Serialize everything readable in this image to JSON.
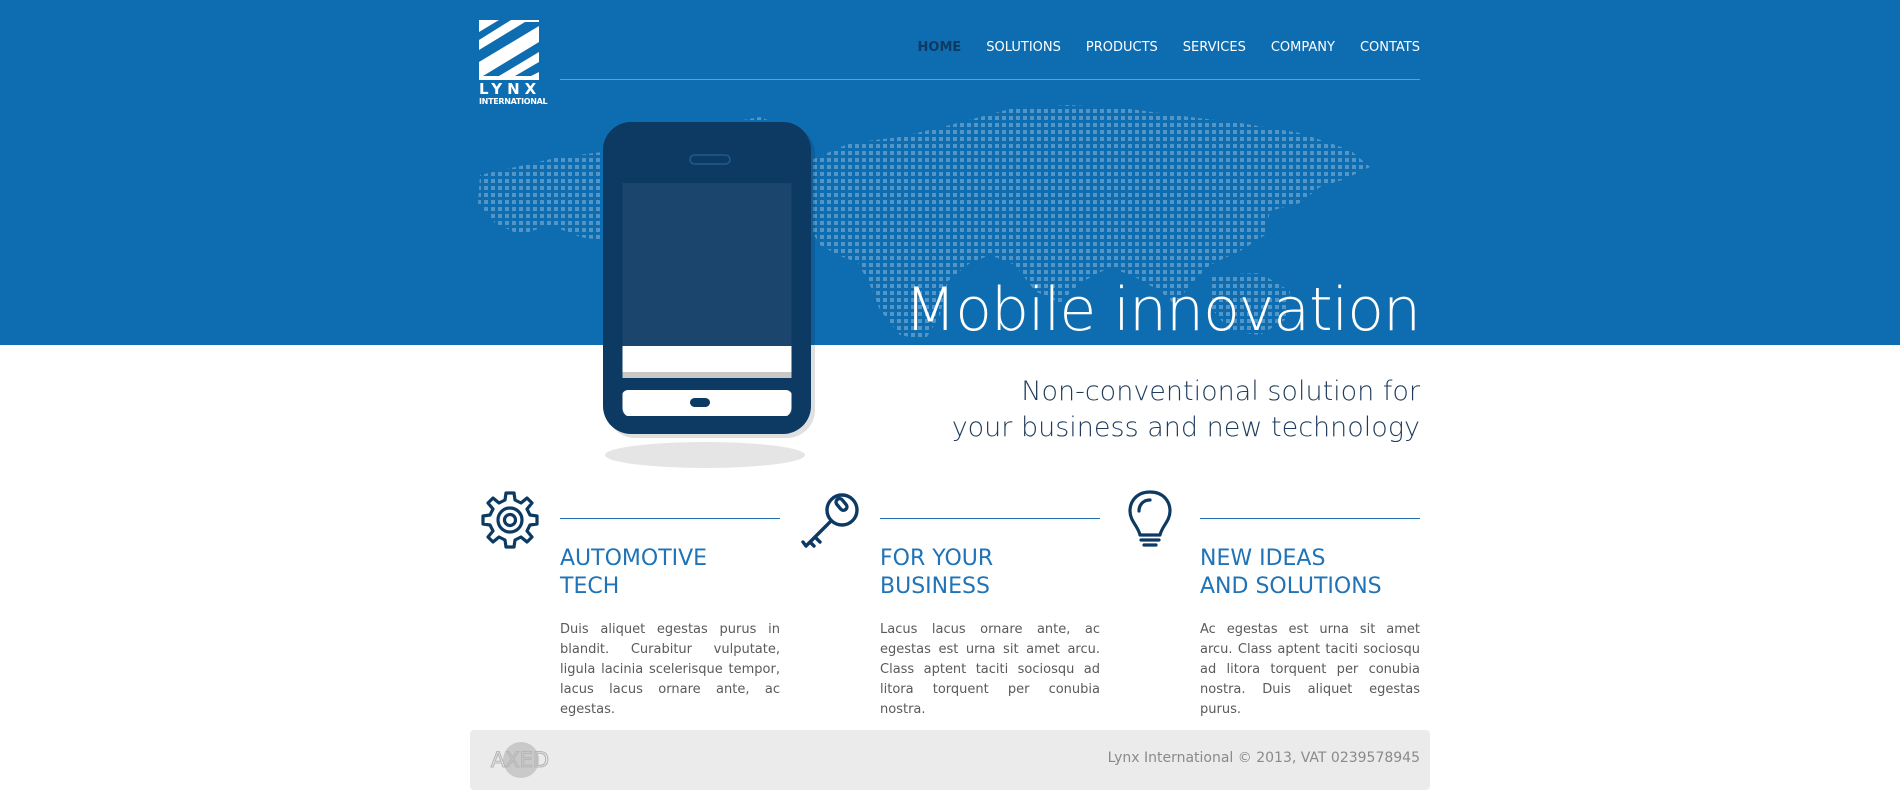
{
  "brand": {
    "name": "LYNX",
    "subtitle": "INTERNATIONAL"
  },
  "nav": {
    "items": [
      {
        "label": "HOME",
        "active": true
      },
      {
        "label": "SOLUTIONS",
        "active": false
      },
      {
        "label": "PRODUCTS",
        "active": false
      },
      {
        "label": "SERVICES",
        "active": false
      },
      {
        "label": "COMPANY",
        "active": false
      },
      {
        "label": "CONTATS",
        "active": false
      }
    ]
  },
  "hero": {
    "title": "Mobile innovation",
    "tagline_line1": "Non-conventional solution for",
    "tagline_line2": "your business and new technology"
  },
  "features": [
    {
      "icon": "gear-icon",
      "heading_line1": "AUTOMOTIVE",
      "heading_line2": "TECH",
      "text": "Duis aliquet egestas purus in blandit. Curabitur vulputate, ligula lacinia scelerisque tempor, lacus lacus ornare ante, ac egestas."
    },
    {
      "icon": "key-icon",
      "heading_line1": "FOR YOUR",
      "heading_line2": "BUSINESS",
      "text": "Lacus lacus ornare ante, ac egestas est urna sit amet arcu. Class aptent taciti sociosqu ad litora torquent per conubia nostra."
    },
    {
      "icon": "lightbulb-icon",
      "heading_line1": "NEW IDEAS",
      "heading_line2": "AND SOLUTIONS",
      "text": "Ac egestas est urna sit amet arcu. Class aptent taciti sociosqu ad litora torquent per conubia nostra. Duis aliquet egestas purus."
    }
  ],
  "footer": {
    "partner_logo_text": "AXED",
    "copyright": "Lynx International © 2013, VAT 0239578945"
  },
  "colors": {
    "hero_blue": "#0e6db1",
    "dark_navy": "#0d3a63",
    "heading_blue": "#1f73b6",
    "footer_bg": "#ebebeb"
  }
}
